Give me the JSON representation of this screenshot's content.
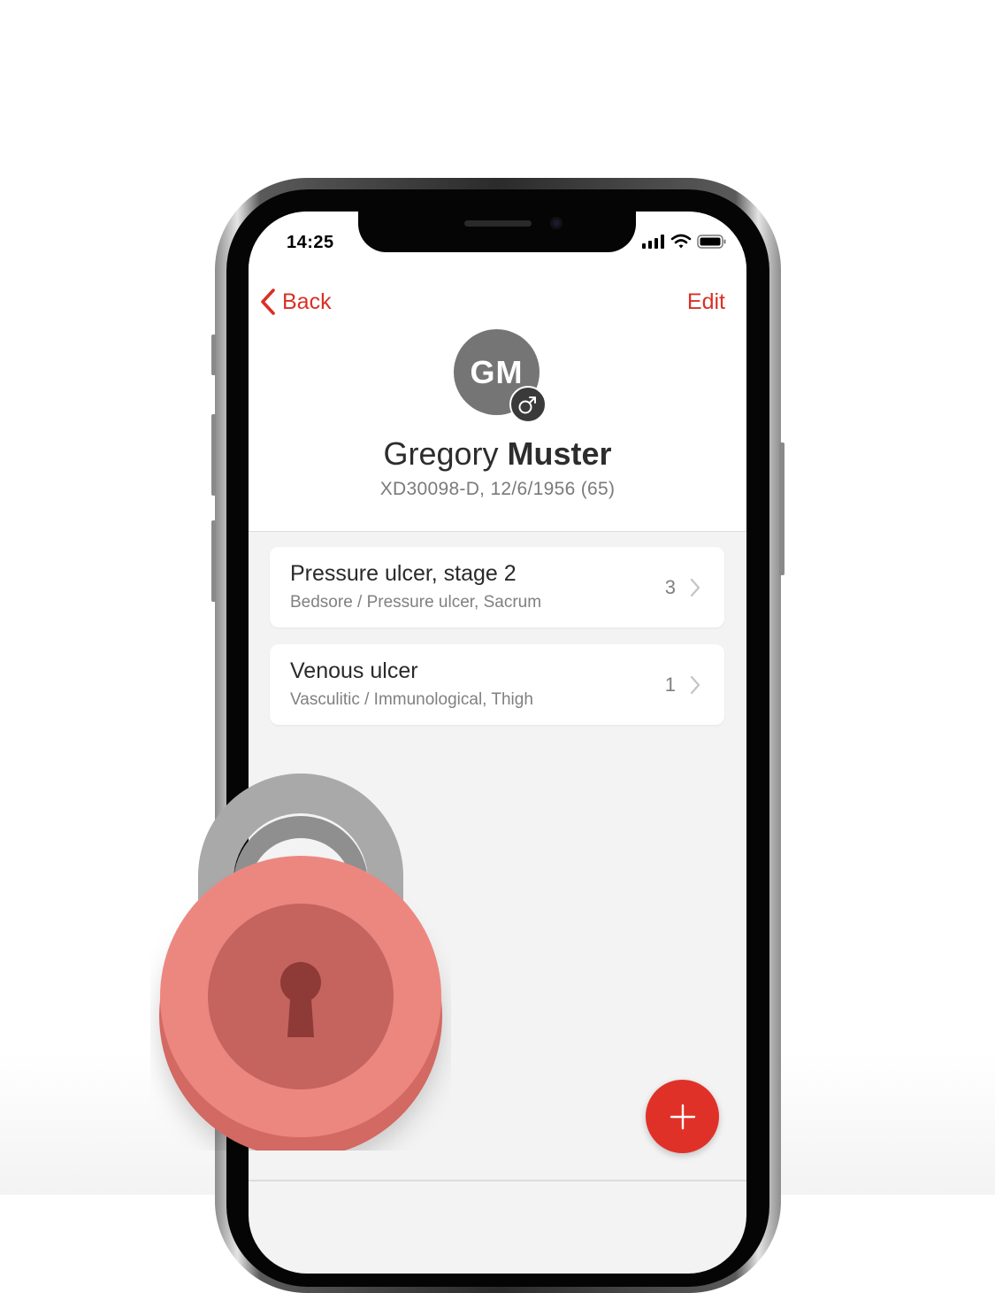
{
  "status_bar": {
    "time": "14:25"
  },
  "nav": {
    "back_label": "Back",
    "edit_label": "Edit"
  },
  "patient": {
    "initials": "GM",
    "first_name": "Gregory",
    "last_name": "Muster",
    "meta": "XD30098-D, 12/6/1956 (65)",
    "gender_icon": "male-symbol-icon"
  },
  "wounds": [
    {
      "title": "Pressure ulcer, stage 2",
      "subtitle": "Bedsore / Pressure ulcer, Sacrum",
      "count": "3"
    },
    {
      "title": "Venous ulcer",
      "subtitle": "Vasculitic / Immunological, Thigh",
      "count": "1"
    }
  ],
  "colors": {
    "accent": "#d93025",
    "fab": "#e03129",
    "lock_body": "#ec8780",
    "lock_shackle": "#a9a9a9",
    "avatar": "#757575"
  },
  "icons": {
    "back": "chevron-left-icon",
    "chevron": "chevron-right-icon",
    "fab": "plus-icon",
    "lock": "padlock-icon"
  }
}
